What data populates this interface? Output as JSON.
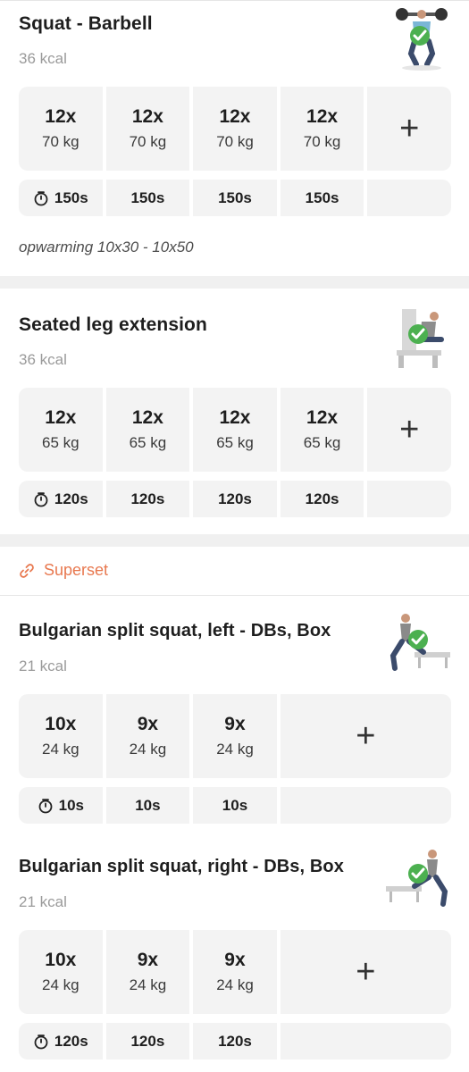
{
  "colors": {
    "accent": "#e8784f",
    "check": "#4cb050",
    "cell_bg": "#f3f3f3",
    "separator": "#f0f0f0"
  },
  "exercises": [
    {
      "title": "Squat - Barbell",
      "kcal": "36 kcal",
      "completed": true,
      "sets": [
        {
          "reps": "12x",
          "weight": "70 kg"
        },
        {
          "reps": "12x",
          "weight": "70 kg"
        },
        {
          "reps": "12x",
          "weight": "70 kg"
        },
        {
          "reps": "12x",
          "weight": "70 kg"
        }
      ],
      "rests": [
        "150s",
        "150s",
        "150s",
        "150s"
      ],
      "note": "opwarming 10x30 - 10x50",
      "add_label": "+"
    },
    {
      "title": "Seated leg extension",
      "kcal": "36 kcal",
      "completed": true,
      "sets": [
        {
          "reps": "12x",
          "weight": "65 kg"
        },
        {
          "reps": "12x",
          "weight": "65 kg"
        },
        {
          "reps": "12x",
          "weight": "65 kg"
        },
        {
          "reps": "12x",
          "weight": "65 kg"
        }
      ],
      "rests": [
        "120s",
        "120s",
        "120s",
        "120s"
      ],
      "add_label": "+"
    },
    {
      "title": "Bulgarian split squat, left - DBs, Box",
      "kcal": "21 kcal",
      "completed": true,
      "sets": [
        {
          "reps": "10x",
          "weight": "24 kg"
        },
        {
          "reps": "9x",
          "weight": "24 kg"
        },
        {
          "reps": "9x",
          "weight": "24 kg"
        }
      ],
      "rests": [
        "10s",
        "10s",
        "10s"
      ],
      "add_label": "+"
    },
    {
      "title": "Bulgarian split squat, right - DBs, Box",
      "kcal": "21 kcal",
      "completed": true,
      "sets": [
        {
          "reps": "10x",
          "weight": "24 kg"
        },
        {
          "reps": "9x",
          "weight": "24 kg"
        },
        {
          "reps": "9x",
          "weight": "24 kg"
        }
      ],
      "rests": [
        "120s",
        "120s",
        "120s"
      ],
      "add_label": "+"
    }
  ],
  "superset": {
    "label": "Superset",
    "icon": "link-icon"
  }
}
